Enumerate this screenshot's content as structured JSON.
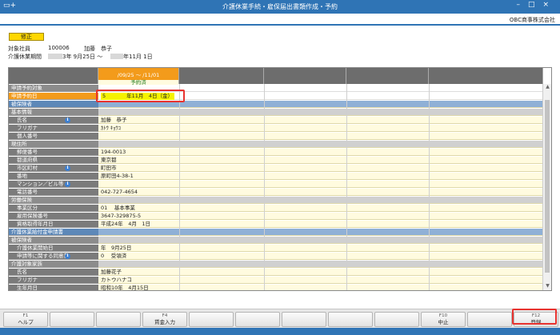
{
  "window": {
    "title": "介護休業手続・雇保届出書類作成・予約"
  },
  "company": "OBC商事株式会社",
  "mode_label": "修正",
  "employee": {
    "label": "対象社員",
    "code": "100006",
    "name": "加藤　恭子",
    "period_label": "介護休業期間",
    "period_from": "3年 9月25日 ～",
    "period_to": "年11月 1日"
  },
  "column_header": {
    "range": "/09/25 ～ /11/01",
    "status": "予約済"
  },
  "rows": [
    {
      "label": "申請予約対象",
      "style": "sec",
      "cells": "white",
      "value": ""
    },
    {
      "label": "申請予約日",
      "style": "orange",
      "cells": "white",
      "value": "5　　　　年11月　4日（金）"
    },
    {
      "label": "被保険者",
      "style": "blue",
      "cells": "blue",
      "value": ""
    },
    {
      "label": "基本情報",
      "style": "sec",
      "cells": "gray",
      "value": ""
    },
    {
      "label": "氏名",
      "style": "sub",
      "cells": "yellow",
      "value": "加藤　恭子",
      "info": true
    },
    {
      "label": "フリガナ",
      "style": "sub",
      "cells": "yellow",
      "value": "ｶﾄｳ ｷｮｳｺ"
    },
    {
      "label": "個人番号",
      "style": "sub",
      "cells": "yellow",
      "value": ""
    },
    {
      "label": "現住所",
      "style": "sec",
      "cells": "gray",
      "value": ""
    },
    {
      "label": "郵便番号",
      "style": "sub",
      "cells": "yellow",
      "value": "194-0013"
    },
    {
      "label": "都道府県",
      "style": "sub",
      "cells": "yellow",
      "value": "東京都"
    },
    {
      "label": "市区町村",
      "style": "sub",
      "cells": "yellow",
      "value": "町田市",
      "info": true
    },
    {
      "label": "番地",
      "style": "sub",
      "cells": "yellow",
      "value": "原町田4-38-1"
    },
    {
      "label": "マンション／ビル等",
      "style": "sub",
      "cells": "yellow",
      "value": "",
      "info": true
    },
    {
      "label": "電話番号",
      "style": "sub",
      "cells": "yellow",
      "value": "042-727-4654"
    },
    {
      "label": "労働保険",
      "style": "sec",
      "cells": "gray",
      "value": ""
    },
    {
      "label": "事業区分",
      "style": "sub",
      "cells": "yellow",
      "value": "01　 基本事業"
    },
    {
      "label": "雇用保険番号",
      "style": "sub",
      "cells": "yellow",
      "value": "3647-329875-5"
    },
    {
      "label": "資格取得年月日",
      "style": "sub",
      "cells": "yellow",
      "value": "平成24年　4月　1日"
    },
    {
      "label": "介護休業給付金申請書",
      "style": "blue",
      "cells": "blue",
      "value": ""
    },
    {
      "label": "被保険者",
      "style": "sec",
      "cells": "gray",
      "value": ""
    },
    {
      "label": "介護休業開始日",
      "style": "sub",
      "cells": "yellow",
      "value": "年　9月25日"
    },
    {
      "label": "申請等に関する同意書",
      "style": "sub",
      "cells": "yellow",
      "value": "0　 受領済",
      "info": true
    },
    {
      "label": "介護対象家族",
      "style": "sec",
      "cells": "gray",
      "value": ""
    },
    {
      "label": "氏名",
      "style": "sub",
      "cells": "yellow",
      "value": "加藤花子"
    },
    {
      "label": "フリガナ",
      "style": "sub",
      "cells": "yellow",
      "value": "カトウハナコ"
    },
    {
      "label": "生年月日",
      "style": "sub",
      "cells": "yellow",
      "value": "昭和10年　4月15日"
    }
  ],
  "fkeys": [
    {
      "key": "F1",
      "label": "ヘルプ"
    },
    {
      "key": "",
      "label": ""
    },
    {
      "key": "",
      "label": ""
    },
    {
      "key": "F4",
      "label": "賃金入力"
    },
    {
      "key": "",
      "label": ""
    },
    {
      "key": "",
      "label": ""
    },
    {
      "key": "",
      "label": ""
    },
    {
      "key": "",
      "label": ""
    },
    {
      "key": "",
      "label": ""
    },
    {
      "key": "F10",
      "label": "中止"
    },
    {
      "key": "",
      "label": ""
    },
    {
      "key": "F12",
      "label": "登録"
    }
  ],
  "colors": {
    "accent": "#2f74b5",
    "selected_column": "#f39b1b",
    "highlight": "#e8332f"
  }
}
